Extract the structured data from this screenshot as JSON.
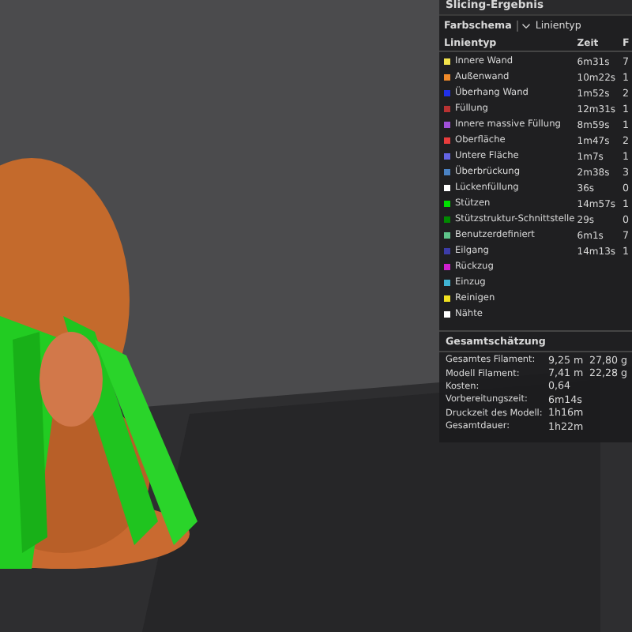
{
  "panel": {
    "title": "Slicing-Ergebnis",
    "color_scheme": {
      "label": "Farbschema",
      "value": "Linientyp"
    },
    "columns": [
      "Linientyp",
      "Zeit",
      "F"
    ],
    "rows": [
      {
        "label": "Innere Wand",
        "time": "6m31s",
        "column_3": "7",
        "color": "#f2e24b"
      },
      {
        "label": "Außenwand",
        "time": "10m22s",
        "column_3": "1",
        "color": "#f08a2a"
      },
      {
        "label": "Überhang Wand",
        "time": "1m52s",
        "column_3": "2",
        "color": "#2030e8"
      },
      {
        "label": "Füllung",
        "time": "12m31s",
        "column_3": "1",
        "color": "#b83232"
      },
      {
        "label": "Innere massive Füllung",
        "time": "8m59s",
        "column_3": "1",
        "color": "#a050d8"
      },
      {
        "label": "Oberfläche",
        "time": "1m47s",
        "column_3": "2",
        "color": "#e83c3c"
      },
      {
        "label": "Untere Fläche",
        "time": "1m7s",
        "column_3": "1",
        "color": "#6464e4"
      },
      {
        "label": "Überbrückung",
        "time": "2m38s",
        "column_3": "3",
        "color": "#4a82c4"
      },
      {
        "label": "Lückenfüllung",
        "time": "36s",
        "column_3": "0",
        "color": "#ffffff"
      },
      {
        "label": "Stützen",
        "time": "14m57s",
        "column_3": "1",
        "color": "#00e000"
      },
      {
        "label": "Stützstruktur-Schnittstelle",
        "time": "29s",
        "column_3": "0",
        "color": "#008a00"
      },
      {
        "label": "Benutzerdefiniert",
        "time": "6m1s",
        "column_3": "7",
        "color": "#5ec48a"
      },
      {
        "label": "Eilgang",
        "time": "14m13s",
        "column_3": "1",
        "color": "#3c3ca8"
      },
      {
        "label": "Rückzug",
        "color": "#d020d0"
      },
      {
        "label": "Einzug",
        "color": "#40b4d4"
      },
      {
        "label": "Reinigen",
        "color": "#f0e020"
      },
      {
        "label": "Nähte",
        "color": "#ffffff"
      }
    ],
    "summary": {
      "title": "Gesamtschätzung",
      "rows": [
        {
          "label": "Gesamtes Filament:",
          "value": "9,25 m",
          "value_2": "27,80 g"
        },
        {
          "label": "Modell Filament:",
          "value": "7,41 m",
          "value_2": "22,28 g"
        },
        {
          "label": "Kosten:",
          "value": "0,64"
        },
        {
          "label": "Vorbereitungszeit:",
          "value": "6m14s"
        },
        {
          "label": "Druckzeit des Modell:",
          "value": "1h16m"
        },
        {
          "label": "Gesamtdauer:",
          "value": "1h22m"
        }
      ]
    }
  }
}
